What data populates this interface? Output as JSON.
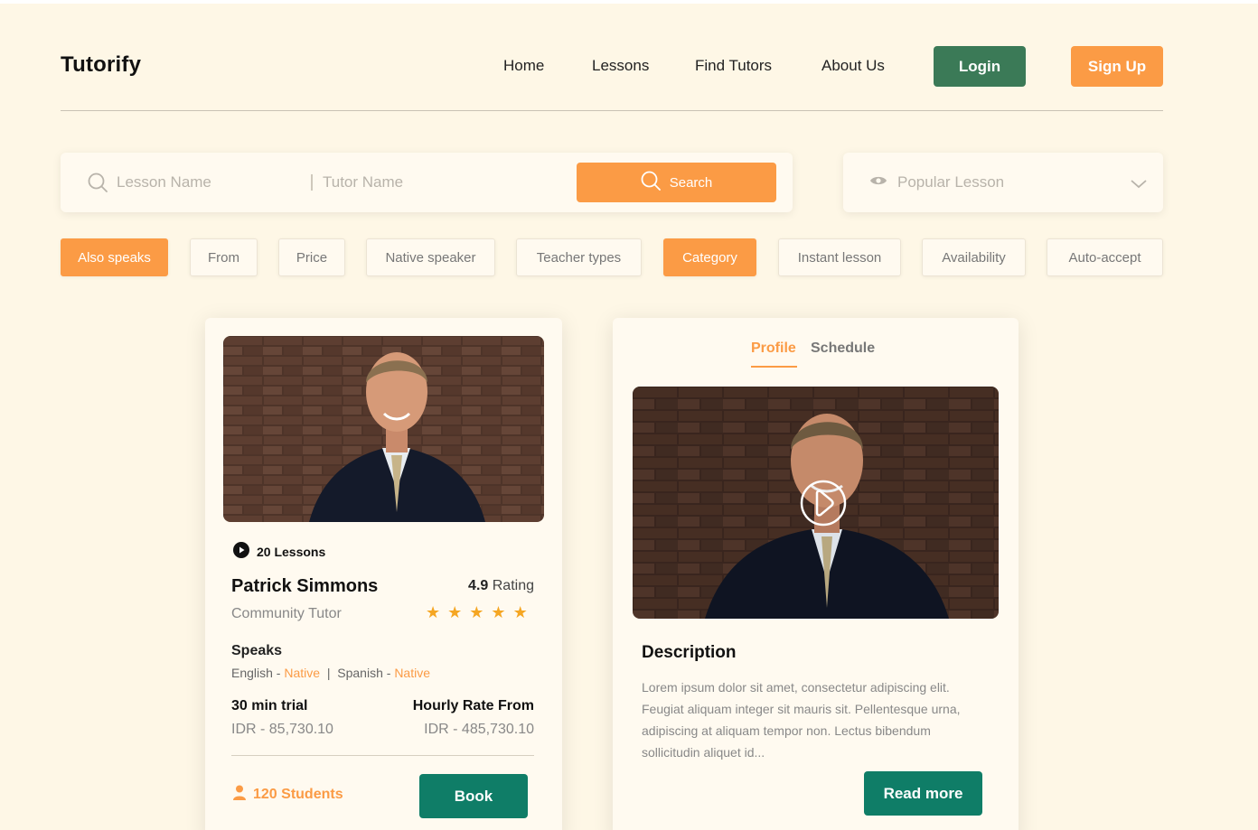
{
  "brand": {
    "name": "Tutorify"
  },
  "nav": {
    "links": [
      "Home",
      "Lessons",
      "Find Tutors",
      "About Us"
    ],
    "login_label": "Login",
    "signup_label": "Sign Up"
  },
  "search": {
    "lesson_placeholder": "Lesson Name",
    "tutor_placeholder": "Tutor Name",
    "button_label": "Search",
    "sort_selected": "Popular Lesson"
  },
  "filters": [
    {
      "label": "Also speaks",
      "active": true
    },
    {
      "label": "From",
      "active": false
    },
    {
      "label": "Price",
      "active": false
    },
    {
      "label": "Native speaker",
      "active": false
    },
    {
      "label": "Teacher types",
      "active": false
    },
    {
      "label": "Category",
      "active": true
    },
    {
      "label": "Instant lesson",
      "active": false
    },
    {
      "label": "Availability",
      "active": false
    },
    {
      "label": "Auto-accept",
      "active": false
    }
  ],
  "tutor_card": {
    "lessons": "20 Lessons",
    "name": "Patrick Simmons",
    "role": "Community Tutor",
    "rating_value": "4.9",
    "rating_label": "Rating",
    "stars": 5,
    "speaks_title": "Speaks",
    "languages": [
      {
        "language": "English",
        "level": "Native"
      },
      {
        "language": "Spanish",
        "level": "Native"
      }
    ],
    "trial_title": "30 min trial",
    "trial_price": "IDR - 85,730.10",
    "rate_title": "Hourly Rate From",
    "rate_price": "IDR - 485,730.10",
    "students": "120 Students",
    "book_label": "Book"
  },
  "profile_card": {
    "tabs": [
      "Profile",
      "Schedule"
    ],
    "active_tab": "Profile",
    "description_title": "Description",
    "description_text": "Lorem ipsum dolor sit amet, consectetur adipiscing elit. Feugiat aliquam integer sit mauris sit. Pellentesque urna, adipiscing at aliquam tempor non. Lectus bibendum sollicitudin aliquet id...",
    "read_more_label": "Read more"
  },
  "colors": {
    "background": "#fef7e6",
    "accent_orange": "#fb9b45",
    "login_green": "#3b7a57",
    "action_green": "#0f7d67"
  }
}
